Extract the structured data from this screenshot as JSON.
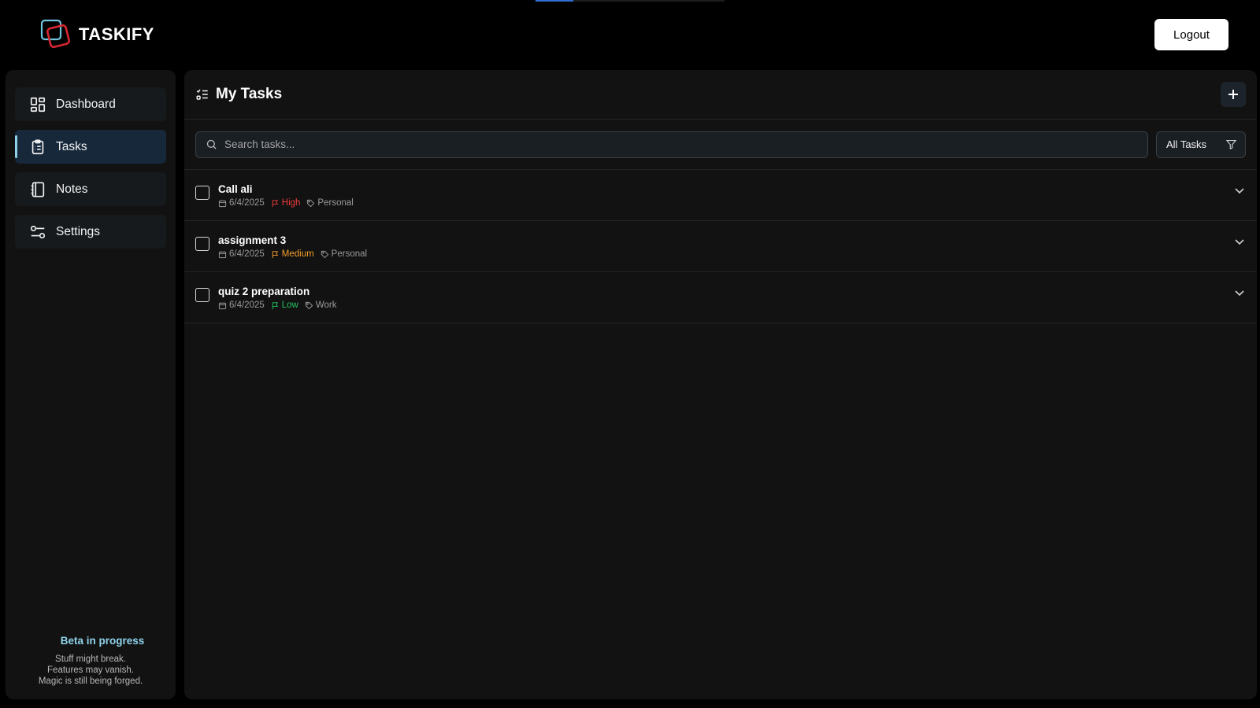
{
  "app": {
    "name": "TASKIFY",
    "loading_progress": 0.2
  },
  "header": {
    "logout_label": "Logout"
  },
  "sidebar": {
    "items": [
      {
        "label": "Dashboard",
        "icon": "dashboard-icon",
        "active": false
      },
      {
        "label": "Tasks",
        "icon": "clipboard-list-icon",
        "active": true
      },
      {
        "label": "Notes",
        "icon": "notebook-icon",
        "active": false
      },
      {
        "label": "Settings",
        "icon": "sliders-icon",
        "active": false
      }
    ],
    "beta": {
      "title": "Beta in progress",
      "lines": [
        "Stuff might break.",
        "Features may vanish.",
        "Magic is still being forged."
      ]
    }
  },
  "main": {
    "title": "My Tasks",
    "search_placeholder": "Search tasks...",
    "filter_label": "All Tasks",
    "tasks": [
      {
        "title": "Call ali",
        "date": "6/4/2025",
        "priority": "High",
        "category": "Personal"
      },
      {
        "title": "assignment 3",
        "date": "6/4/2025",
        "priority": "Medium",
        "category": "Personal"
      },
      {
        "title": "quiz 2 preparation",
        "date": "6/4/2025",
        "priority": "Low",
        "category": "Work"
      }
    ]
  },
  "colors": {
    "accent": "#8fd3ea",
    "priority_high": "#ef3b3b",
    "priority_medium": "#f59e2b",
    "priority_low": "#22c55e",
    "logo_red": "#d92632",
    "logo_blue": "#6ec3dd"
  }
}
